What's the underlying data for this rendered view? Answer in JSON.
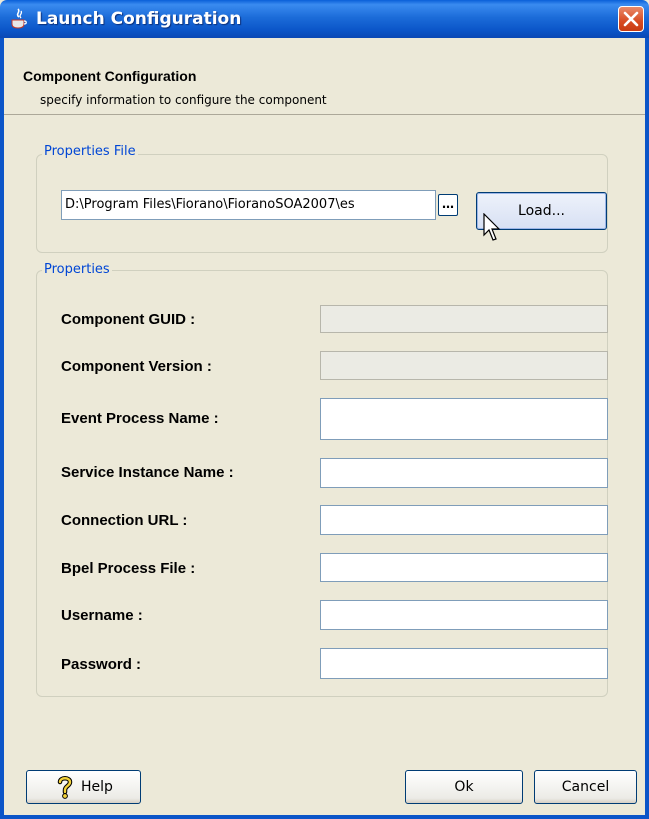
{
  "window": {
    "title": "Launch Configuration"
  },
  "banner": {
    "title": "Component Configuration",
    "subtitle": "specify information to configure the component"
  },
  "properties_file": {
    "group_label": "Properties File",
    "path_value": "D:\\Program Files\\Fiorano\\FioranoSOA2007\\es",
    "browse_label": "…",
    "load_label": "Load..."
  },
  "properties": {
    "group_label": "Properties",
    "fields": [
      {
        "label": "Component GUID :",
        "value": "",
        "disabled": true
      },
      {
        "label": "Component Version :",
        "value": "",
        "disabled": true
      },
      {
        "label": "Event Process Name :",
        "value": "",
        "disabled": false
      },
      {
        "label": "Service Instance Name :",
        "value": "",
        "disabled": false
      },
      {
        "label": "Connection URL :",
        "value": "",
        "disabled": false
      },
      {
        "label": "Bpel Process File :",
        "value": "",
        "disabled": false
      },
      {
        "label": "Username :",
        "value": "",
        "disabled": false
      },
      {
        "label": "Password :",
        "value": "",
        "disabled": false
      }
    ]
  },
  "buttons": {
    "help": "Help",
    "ok": "Ok",
    "cancel": "Cancel"
  },
  "colors": {
    "titlebar": "#0b55c8",
    "group_title": "#0046d5",
    "close": "#d84b22",
    "background": "#ece9d8"
  }
}
